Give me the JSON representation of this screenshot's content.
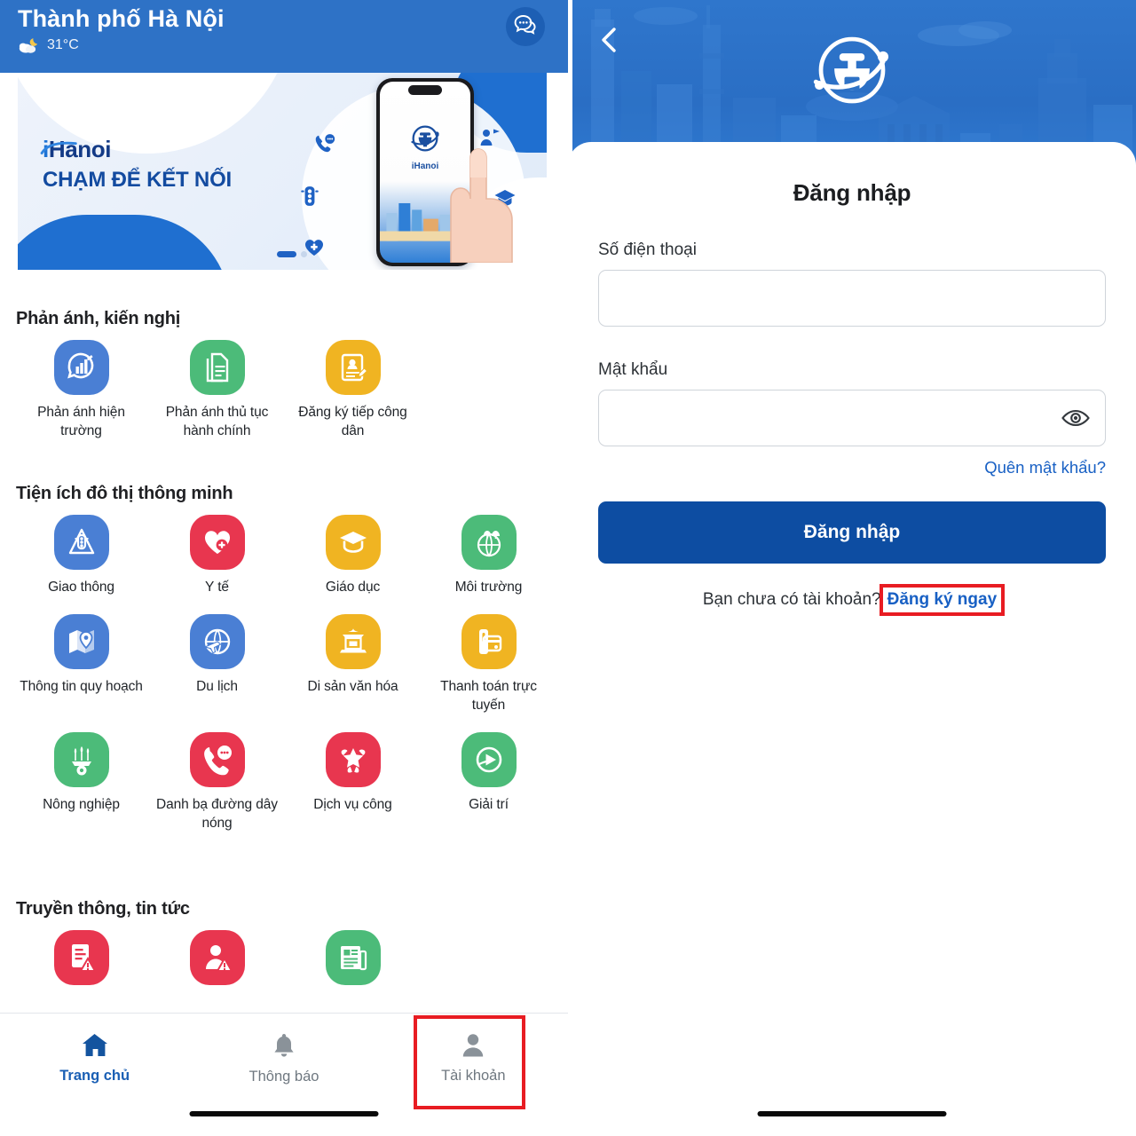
{
  "left": {
    "header": {
      "city_title": "Thành phố Hà Nội",
      "weather_temp": "31°C",
      "weather_icon": "moon-cloud-icon",
      "chat_icon": "chat-bubble-icon"
    },
    "banner": {
      "brand": "Hanoi",
      "brand_prefix": "i",
      "slogan": "CHẠM ĐỂ KẾT NỐI",
      "phone_brand": "iHanoi"
    },
    "sections": [
      {
        "title": "Phản ánh, kiến nghị",
        "columns": 3,
        "items": [
          {
            "label": "Phản ánh hiện trường",
            "icon": "megaphone-chart-icon",
            "color": "#4a7fd4"
          },
          {
            "label": "Phản ánh thủ tục hành chính",
            "icon": "documents-icon",
            "color": "#4cbb79"
          },
          {
            "label": "Đăng ký tiếp công dân",
            "icon": "id-card-pencil-icon",
            "color": "#f0b422"
          }
        ]
      },
      {
        "title": "Tiện ích đô thị thông minh",
        "columns": 4,
        "items": [
          {
            "label": "Giao thông",
            "icon": "traffic-light-icon",
            "color": "#4a7fd4"
          },
          {
            "label": "Y tế",
            "icon": "heart-cross-icon",
            "color": "#e8364f"
          },
          {
            "label": "Giáo dục",
            "icon": "graduation-cap-icon",
            "color": "#f0b422"
          },
          {
            "label": "Môi trường",
            "icon": "eco-globe-icon",
            "color": "#4cbb79"
          },
          {
            "label": "Thông tin quy hoạch",
            "icon": "map-pin-icon",
            "color": "#4a7fd4"
          },
          {
            "label": "Du lịch",
            "icon": "globe-plane-icon",
            "color": "#4a7fd4"
          },
          {
            "label": "Di sản văn hóa",
            "icon": "pagoda-gate-icon",
            "color": "#f0b422"
          },
          {
            "label": "Thanh toán trực tuyến",
            "icon": "wallet-card-icon",
            "color": "#f0b422"
          },
          {
            "label": "Nông nghiệp",
            "icon": "wheat-gear-icon",
            "color": "#4cbb79"
          },
          {
            "label": "Danh bạ đường dây nóng",
            "icon": "phone-chat-icon",
            "color": "#e8364f"
          },
          {
            "label": "Dịch vụ công",
            "icon": "hands-star-icon",
            "color": "#e8364f"
          },
          {
            "label": "Giải trí",
            "icon": "play-circle-icon",
            "color": "#4cbb79"
          }
        ]
      },
      {
        "title": "Truyền thông, tin tức",
        "columns": 3,
        "items": [
          {
            "label": "",
            "icon": "document-alert-icon",
            "color": "#e8364f"
          },
          {
            "label": "",
            "icon": "person-alert-icon",
            "color": "#e8364f"
          },
          {
            "label": "",
            "icon": "newspaper-icon",
            "color": "#4cbb79"
          }
        ]
      }
    ],
    "bottom_nav": [
      {
        "label": "Trang chủ",
        "icon": "home-icon",
        "active": true
      },
      {
        "label": "Thông báo",
        "icon": "bell-icon",
        "active": false
      },
      {
        "label": "Tài khoản",
        "icon": "person-icon",
        "active": false,
        "highlighted": true
      }
    ]
  },
  "right": {
    "back_icon": "chevron-left-icon",
    "logo_icon": "ihanoi-logo-icon",
    "title": "Đăng nhập",
    "phone_label": "Số điện thoại",
    "phone_value": "",
    "phone_placeholder": "",
    "password_label": "Mật khẩu",
    "password_value": "",
    "password_placeholder": "",
    "toggle_password_icon": "eye-icon",
    "forgot_password": "Quên mật khẩu?",
    "login_button": "Đăng nhập",
    "register_question": "Bạn chưa có tài khoản?",
    "register_link": "Đăng ký ngay"
  },
  "colors": {
    "header_blue": "#2e72c6",
    "login_button_blue": "#0d4da2",
    "link_blue": "#1860c4",
    "highlight_red": "#e81c22"
  }
}
